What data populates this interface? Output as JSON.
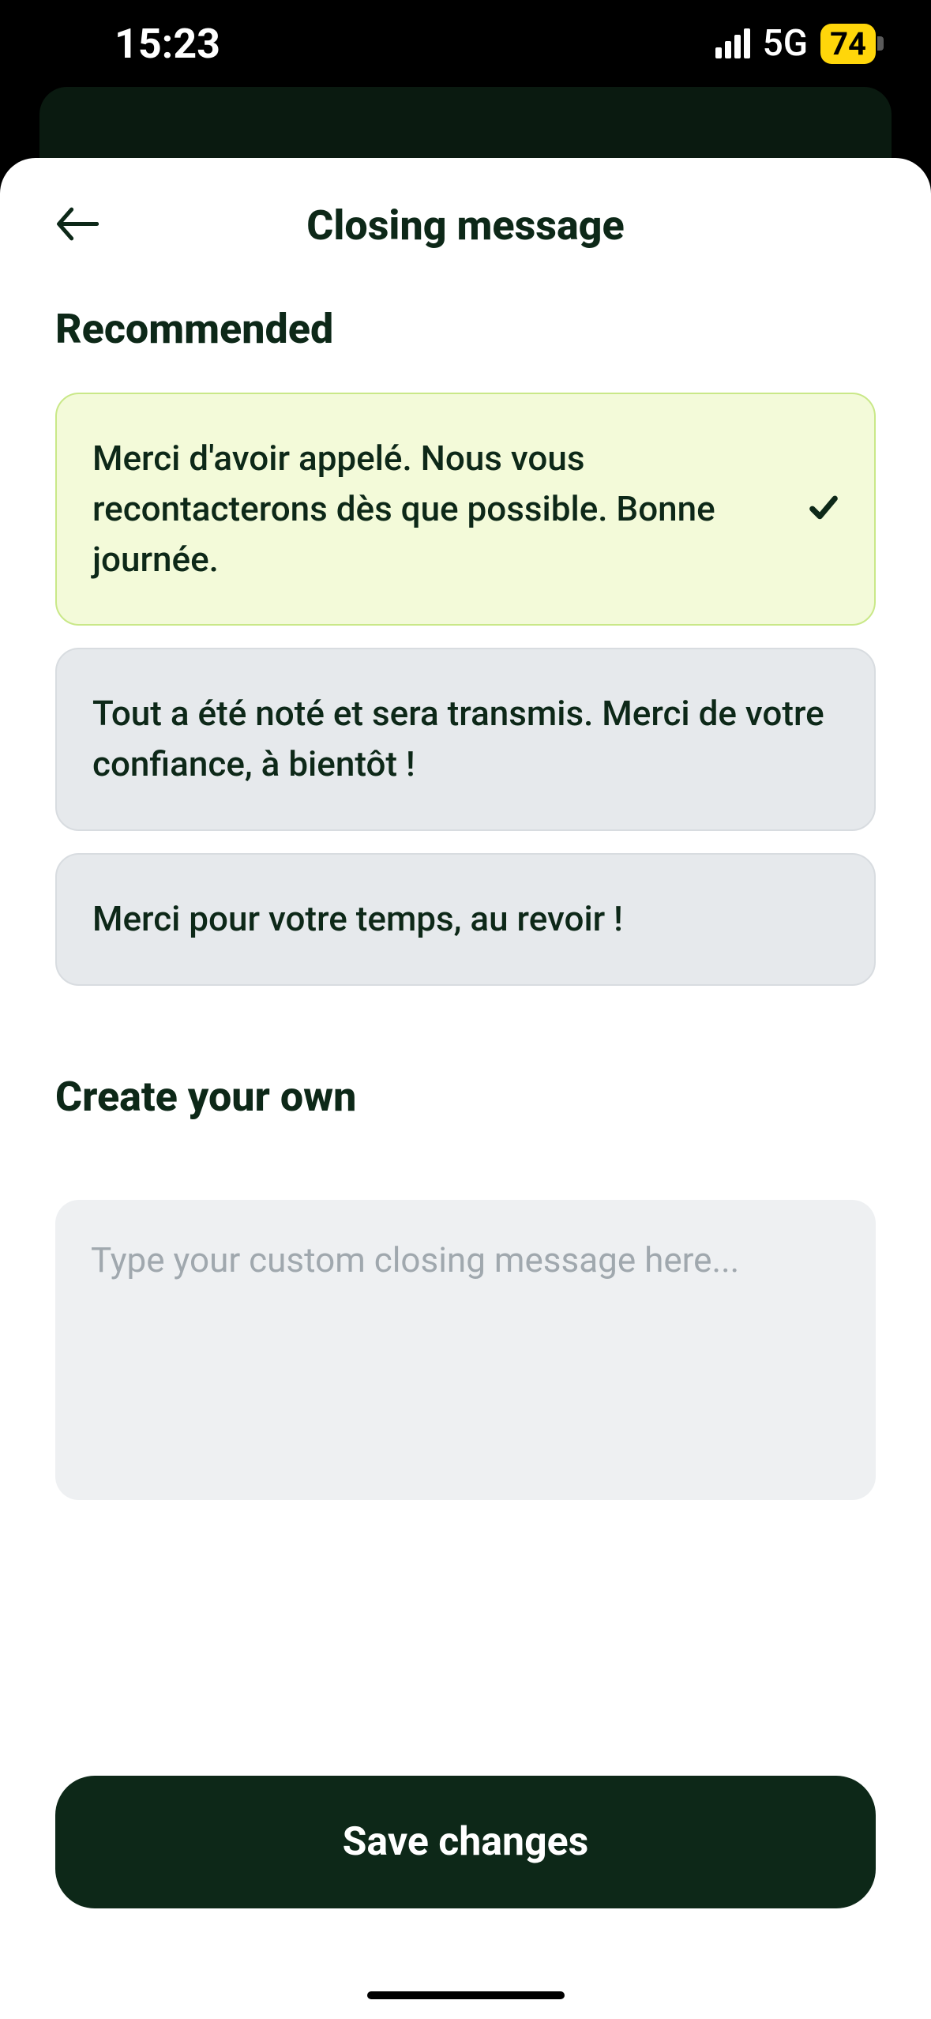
{
  "status": {
    "time": "15:23",
    "network": "5G",
    "battery": "74"
  },
  "header": {
    "title": "Closing message"
  },
  "sections": {
    "recommended": {
      "heading": "Recommended",
      "options": [
        {
          "text": "Merci d'avoir appelé. Nous vous recontacterons dès que possible. Bonne journée.",
          "selected": true
        },
        {
          "text": "Tout a été noté et sera transmis. Merci de votre confiance, à bientôt !",
          "selected": false
        },
        {
          "text": "Merci pour votre temps, au revoir !",
          "selected": false
        }
      ]
    },
    "custom": {
      "heading": "Create your own",
      "placeholder": "Type your custom closing message here..."
    }
  },
  "actions": {
    "save": "Save changes"
  }
}
